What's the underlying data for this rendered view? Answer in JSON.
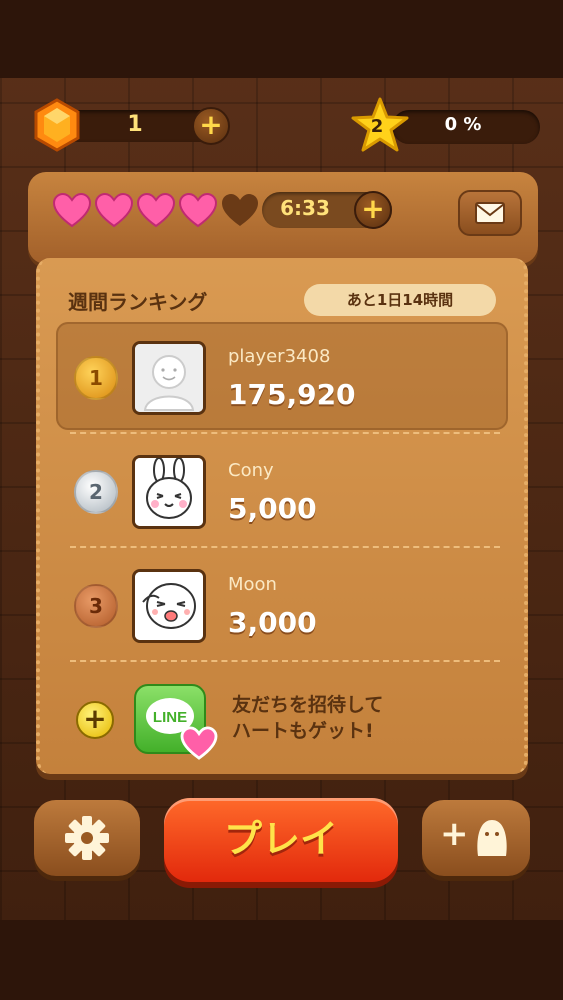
{
  "top_bar": {
    "gem_count": "1",
    "add_gems_label": "+",
    "level": "2",
    "progress_text": "0 %"
  },
  "hearts": {
    "full_count": 4,
    "total": 5,
    "timer": "6:33",
    "add_hearts_label": "+"
  },
  "ranking": {
    "title": "週間ランキング",
    "time_left": "あと1日14時間",
    "entries": [
      {
        "rank": "1",
        "name": "player3408",
        "score": "175,920"
      },
      {
        "rank": "2",
        "name": "Cony",
        "score": "5,000"
      },
      {
        "rank": "3",
        "name": "Moon",
        "score": "3,000"
      }
    ],
    "invite": {
      "add_label": "+",
      "logo_text": "LINE",
      "line1": "友だちを招待して",
      "line2": "ハートもゲット!"
    }
  },
  "bottom": {
    "play_label": "プレイ",
    "add_friend_label": "+"
  },
  "colors": {
    "gold": "#e0a020",
    "silver": "#c9d2d8",
    "bronze": "#c8703a",
    "heart": "#ff5fa8",
    "play_red": "#e8330f",
    "play_text": "#ffe34a"
  }
}
